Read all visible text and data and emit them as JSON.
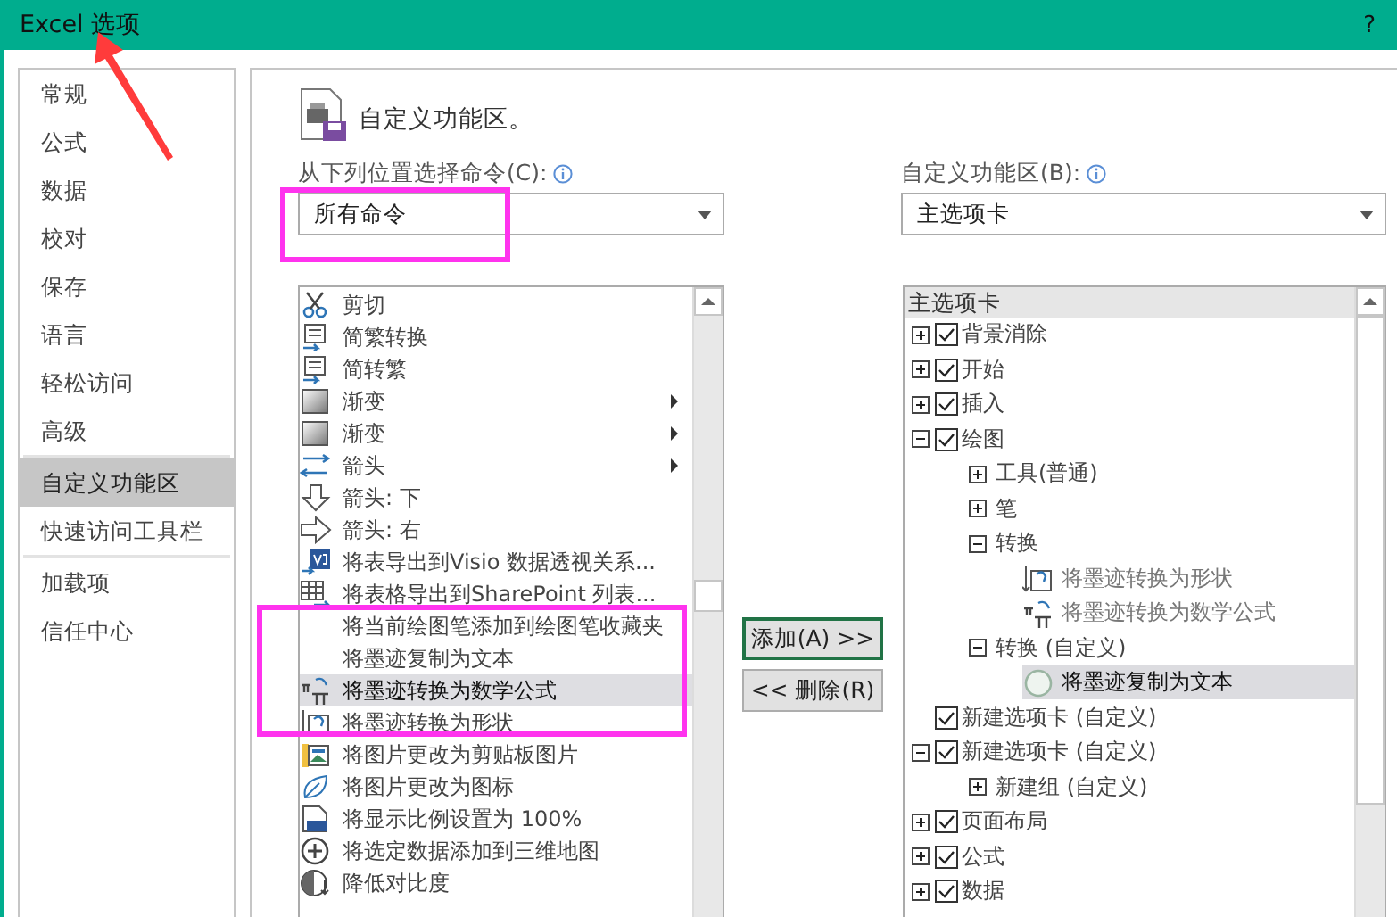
{
  "window": {
    "title": "Excel 选项",
    "help": "?"
  },
  "sidebar": {
    "groups": [
      [
        {
          "label": "常规",
          "selected": false
        },
        {
          "label": "公式",
          "selected": false
        },
        {
          "label": "数据",
          "selected": false
        },
        {
          "label": "校对",
          "selected": false
        },
        {
          "label": "保存",
          "selected": false
        },
        {
          "label": "语言",
          "selected": false
        },
        {
          "label": "轻松访问",
          "selected": false
        },
        {
          "label": "高级",
          "selected": false
        }
      ],
      [
        {
          "label": "自定义功能区",
          "selected": true
        },
        {
          "label": "快速访问工具栏",
          "selected": false
        }
      ],
      [
        {
          "label": "加载项",
          "selected": false
        },
        {
          "label": "信任中心",
          "selected": false
        }
      ]
    ]
  },
  "main": {
    "heading": "自定义功能区。",
    "commands": {
      "label": "从下列位置选择命令(C):",
      "dropdown": "所有命令",
      "items": [
        {
          "label": "剪切",
          "submenu": false,
          "selected": false
        },
        {
          "label": "简繁转换",
          "submenu": false,
          "selected": false
        },
        {
          "label": "简转繁",
          "submenu": false,
          "selected": false
        },
        {
          "label": "渐变",
          "submenu": true,
          "selected": false
        },
        {
          "label": "渐变",
          "submenu": true,
          "selected": false
        },
        {
          "label": "箭头",
          "submenu": true,
          "selected": false
        },
        {
          "label": "箭头: 下",
          "submenu": false,
          "selected": false
        },
        {
          "label": "箭头: 右",
          "submenu": false,
          "selected": false
        },
        {
          "label": "将表导出到Visio 数据透视关系...",
          "submenu": false,
          "selected": false
        },
        {
          "label": "将表格导出到SharePoint 列表...",
          "submenu": false,
          "selected": false
        },
        {
          "label": "将当前绘图笔添加到绘图笔收藏夹",
          "submenu": false,
          "selected": false
        },
        {
          "label": "将墨迹复制为文本",
          "submenu": false,
          "selected": false
        },
        {
          "label": "将墨迹转换为数学公式",
          "submenu": false,
          "selected": true
        },
        {
          "label": "将墨迹转换为形状",
          "submenu": false,
          "selected": false
        },
        {
          "label": "将图片更改为剪贴板图片",
          "submenu": false,
          "selected": false
        },
        {
          "label": "将图片更改为图标",
          "submenu": false,
          "selected": false
        },
        {
          "label": "将显示比例设置为 100%",
          "submenu": false,
          "selected": false
        },
        {
          "label": "将选定数据添加到三维地图",
          "submenu": false,
          "selected": false
        },
        {
          "label": "降低对比度",
          "submenu": false,
          "selected": false
        }
      ]
    },
    "buttons": [
      {
        "label": "添加(A) >>",
        "default": true
      },
      {
        "label": "<< 删除(R)",
        "default": false
      }
    ],
    "ribbon": {
      "label": "自定义功能区(B):",
      "dropdown": "主选项卡",
      "header": "主选项卡",
      "tree": [
        {
          "kind": "tab",
          "label": "背景消除",
          "checked": true,
          "expanded": false,
          "selected": false
        },
        {
          "kind": "tab",
          "label": "开始",
          "checked": true,
          "expanded": false,
          "selected": false
        },
        {
          "kind": "tab",
          "label": "插入",
          "checked": true,
          "expanded": false,
          "selected": false
        },
        {
          "kind": "tab",
          "label": "绘图",
          "checked": true,
          "expanded": true,
          "selected": false,
          "children": [
            {
              "kind": "group",
              "label": "工具(普通)",
              "expanded": false,
              "selected": false
            },
            {
              "kind": "group",
              "label": "笔",
              "expanded": false,
              "selected": false
            },
            {
              "kind": "group",
              "label": "转换",
              "expanded": true,
              "selected": false,
              "children": [
                {
                  "kind": "command",
                  "label": "将墨迹转换为形状",
                  "selected": false
                },
                {
                  "kind": "command",
                  "label": "将墨迹转换为数学公式",
                  "selected": false
                }
              ]
            },
            {
              "kind": "group",
              "label": "转换 (自定义)",
              "expanded": true,
              "selected": false,
              "children": [
                {
                  "kind": "command",
                  "label": "将墨迹复制为文本",
                  "selected": true
                }
              ]
            }
          ]
        },
        {
          "kind": "tab",
          "label": "新建选项卡 (自定义)",
          "checked": true,
          "selected": false
        },
        {
          "kind": "tab",
          "label": "新建选项卡 (自定义)",
          "checked": true,
          "expanded": true,
          "selected": false,
          "children": [
            {
              "kind": "group",
              "label": "新建组 (自定义)",
              "expanded": false,
              "selected": false
            }
          ]
        },
        {
          "kind": "tab",
          "label": "页面布局",
          "checked": true,
          "expanded": false,
          "selected": false
        },
        {
          "kind": "tab",
          "label": "公式",
          "checked": true,
          "expanded": false,
          "selected": false
        },
        {
          "kind": "tab",
          "label": "数据",
          "checked": true,
          "expanded": false,
          "selected": false
        }
      ]
    }
  },
  "annotations": [
    {
      "kind": "arrow"
    },
    {
      "kind": "frame"
    },
    {
      "kind": "frame"
    }
  ]
}
